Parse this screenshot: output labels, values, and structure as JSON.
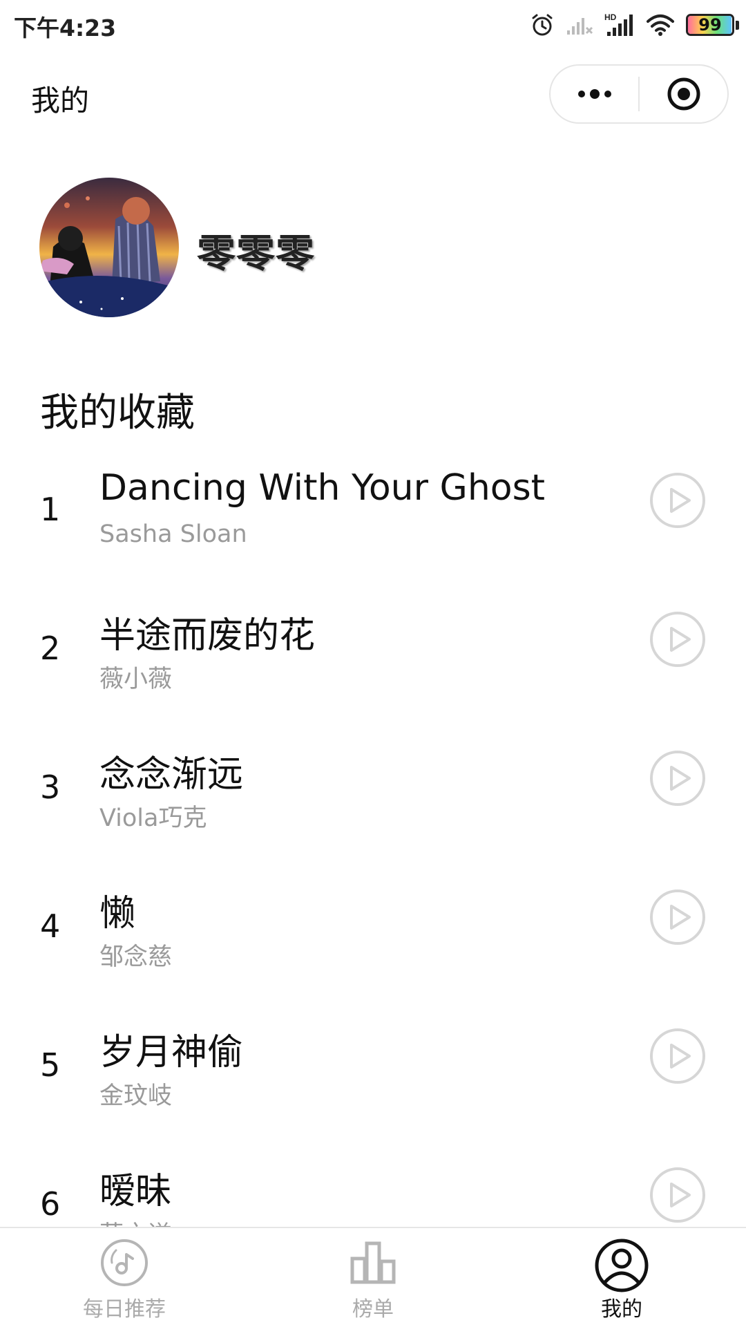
{
  "status_bar": {
    "time": "下午4:23",
    "battery": "99",
    "network_label": "HD"
  },
  "header": {
    "title": "我的",
    "more_icon": "more-dots-icon",
    "close_icon": "target-circle-icon"
  },
  "profile": {
    "username": "零零零",
    "avatar": "user-avatar-image"
  },
  "favorites": {
    "title": "我的收藏",
    "songs": [
      {
        "index": "1",
        "title": "Dancing With Your Ghost",
        "artist": "Sasha Sloan"
      },
      {
        "index": "2",
        "title": "半途而废的花",
        "artist": "薇小薇"
      },
      {
        "index": "3",
        "title": "念念渐远",
        "artist": "Viola巧克"
      },
      {
        "index": "4",
        "title": "懒",
        "artist": "邹念慈"
      },
      {
        "index": "5",
        "title": "岁月神偷",
        "artist": "金玟岐"
      },
      {
        "index": "6",
        "title": "暧昧",
        "artist": "薛之谦"
      }
    ]
  },
  "tab_bar": {
    "tabs": [
      {
        "label": "每日推荐",
        "icon": "music-disc-icon",
        "active": false
      },
      {
        "label": "榜单",
        "icon": "chart-bars-icon",
        "active": false
      },
      {
        "label": "我的",
        "icon": "user-profile-icon",
        "active": true
      }
    ]
  },
  "colors": {
    "text_primary": "#111111",
    "text_secondary": "#9a9a9a",
    "tab_inactive": "#aaaaaa",
    "divider": "#e6e6e6"
  }
}
